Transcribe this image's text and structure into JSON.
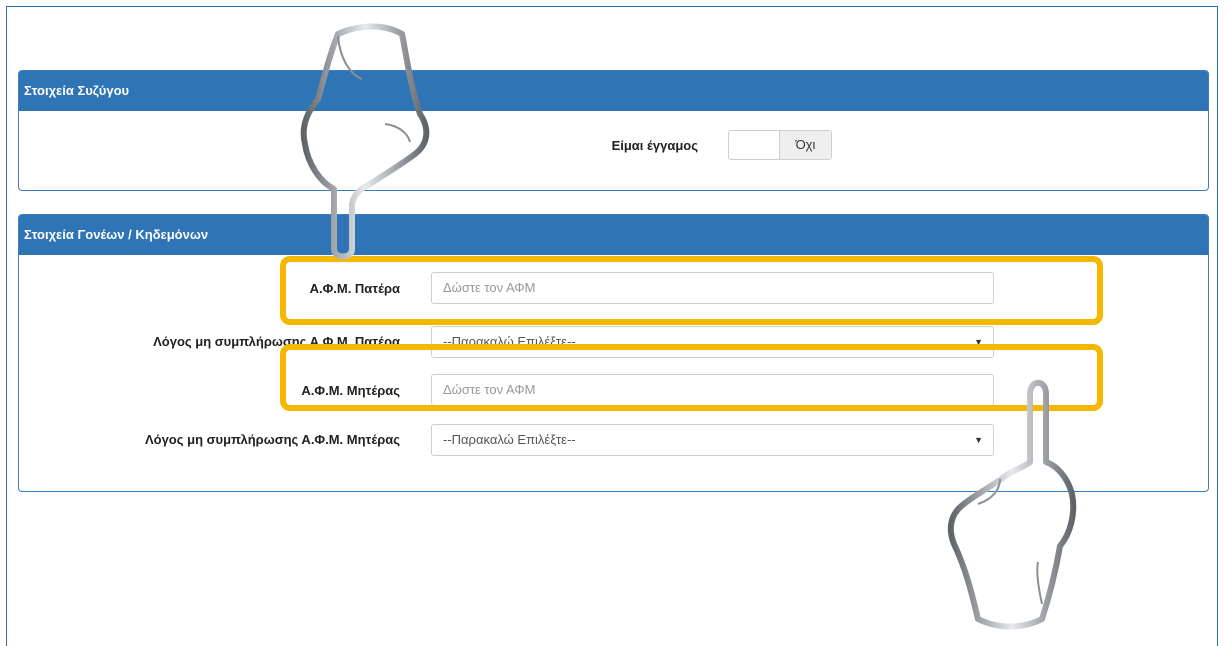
{
  "spouse_panel": {
    "title": "Στοιχεία Συζύγου",
    "married_label": "Είμαι έγγαμος",
    "married_toggle_value": "Όχι"
  },
  "parents_panel": {
    "title": "Στοιχεία Γονέων / Κηδεμόνων",
    "father_afm_label": "Α.Φ.Μ. Πατέρα",
    "father_afm_placeholder": "Δώστε τον ΑΦΜ",
    "father_reason_label": "Λόγος μη συμπλήρωσης Α.Φ.Μ. Πατέρα",
    "father_reason_value": "--Παρακαλώ Επιλέξτε--",
    "mother_afm_label": "Α.Φ.Μ. Μητέρας",
    "mother_afm_placeholder": "Δώστε τον ΑΦΜ",
    "mother_reason_label": "Λόγος μη συμπλήρωσης Α.Φ.Μ. Μητέρας",
    "mother_reason_value": "--Παρακαλώ Επιλέξτε--"
  },
  "colors": {
    "panel_header": "#2f75b5",
    "highlight": "#f5b800"
  },
  "icons": [
    "pointing-hand-icon"
  ]
}
